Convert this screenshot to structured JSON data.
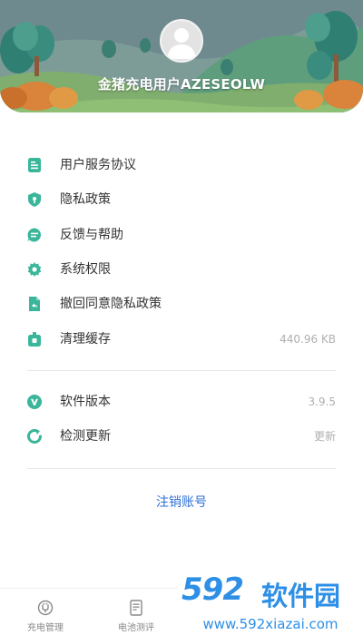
{
  "header": {
    "username": "金猪充电用户AZESEOLW"
  },
  "menu_group1": [
    {
      "name": "user-agreement",
      "icon": "document-icon",
      "label": "用户服务协议",
      "value": ""
    },
    {
      "name": "privacy-policy",
      "icon": "shield-icon",
      "label": "隐私政策",
      "value": ""
    },
    {
      "name": "feedback-help",
      "icon": "chat-icon",
      "label": "反馈与帮助",
      "value": ""
    },
    {
      "name": "system-permissions",
      "icon": "gear-icon",
      "label": "系统权限",
      "value": ""
    },
    {
      "name": "revoke-privacy",
      "icon": "file-revoke-icon",
      "label": "撤回同意隐私政策",
      "value": ""
    },
    {
      "name": "clear-cache",
      "icon": "cleaner-icon",
      "label": "清理缓存",
      "value": "440.96 KB"
    }
  ],
  "menu_group2": [
    {
      "name": "software-version",
      "icon": "version-icon",
      "label": "软件版本",
      "value": "3.9.5"
    },
    {
      "name": "check-update",
      "icon": "refresh-icon",
      "label": "检测更新",
      "value": "更新"
    }
  ],
  "logout_label": "注销账号",
  "tabbar": [
    {
      "name": "tab-charging-management",
      "icon": "plug-icon",
      "label": "充电管理"
    },
    {
      "name": "tab-battery-test",
      "icon": "battery-report-icon",
      "label": "电池测评"
    }
  ],
  "watermark": {
    "brand_num": "592",
    "brand_cn": "软件园",
    "url": "www.592xiazai.com"
  },
  "colors": {
    "accent_green": "#3bb69a",
    "link_blue": "#2f6fd6",
    "watermark_blue": "#2d8fe5"
  }
}
